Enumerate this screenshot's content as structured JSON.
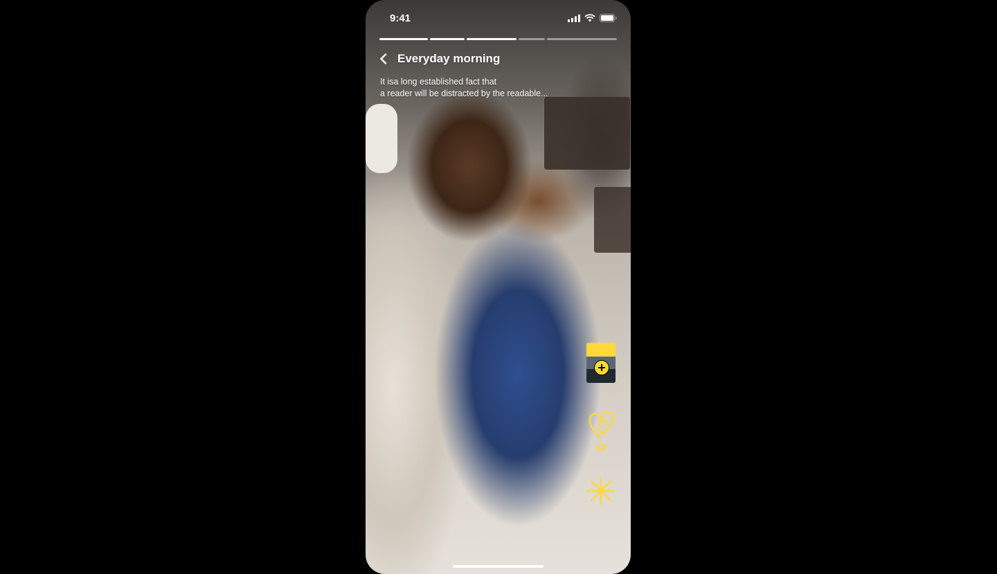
{
  "status": {
    "time": "9:41"
  },
  "story": {
    "progress_total": 5,
    "progress_done": 3,
    "title": "Everyday morning",
    "description_line1": "It isa long established fact that",
    "description_line2": "a reader will be distracted by the readable..."
  },
  "actions": {
    "like_count": "42",
    "accent_color": "#FFD83A"
  },
  "icons": [
    "signal-icon",
    "wifi-icon",
    "battery-icon",
    "back-chevron-icon",
    "plus-icon",
    "heart-icon",
    "sparkle-icon"
  ]
}
